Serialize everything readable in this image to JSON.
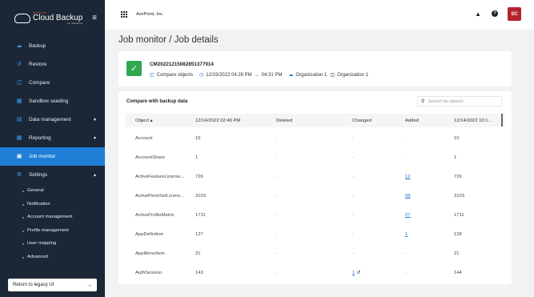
{
  "sidebar": {
    "logo": {
      "brand": "AvePoint",
      "title": "Cloud Backup",
      "subtitle": "For Salesforce"
    },
    "items": [
      {
        "label": "Backup",
        "icon": "cloud-upload-icon"
      },
      {
        "label": "Restore",
        "icon": "restore-icon"
      },
      {
        "label": "Compare",
        "icon": "compare-icon"
      },
      {
        "label": "Sandbox seeding",
        "icon": "database-icon"
      },
      {
        "label": "Data management",
        "icon": "clipboard-icon"
      },
      {
        "label": "Reporting",
        "icon": "chart-icon"
      },
      {
        "label": "Job monitor",
        "icon": "monitor-icon"
      },
      {
        "label": "Settings",
        "icon": "gear-icon"
      }
    ],
    "settings_items": [
      "General",
      "Notification",
      "Account management",
      "Profile management",
      "User mapping",
      "Advanced"
    ],
    "legacy_button": "Return to legacy UI",
    "accent_color": "#1f7fd6"
  },
  "topbar": {
    "tenant": "AvePoint, Inc.",
    "avatar_initials": "SC"
  },
  "page_title": "Job monitor  /  Job details",
  "job": {
    "id": "CM20221215082851377914",
    "type": "Compare objects",
    "time_start": "12/15/2022 04:28 PM",
    "time_end": "04:31 PM",
    "source_org": "Organization 1",
    "target_org": "Organization 1",
    "status_color": "#2fa84f"
  },
  "table": {
    "title": "Compare with backup data",
    "search_placeholder": "Search by objects",
    "columns": [
      "Object ▴",
      "12/14/2022 02:46 PM",
      "Deleted",
      "Changed",
      "Added",
      "12/14/2022 10:1..."
    ],
    "rows": [
      [
        "Account",
        "15",
        "-",
        "-",
        "-",
        "15"
      ],
      [
        "AccountShare",
        "1",
        "-",
        "-",
        "-",
        "1"
      ],
      [
        "ActiveFeatureLicense...",
        "726",
        "-",
        "-",
        "12",
        "726"
      ],
      [
        "ActivePermSetLicens...",
        "3103",
        "-",
        "-",
        "58",
        "3103"
      ],
      [
        "ActiveProfileMetric",
        "1711",
        "-",
        "-",
        "27",
        "1711"
      ],
      [
        "AppDefinition",
        "127",
        "-",
        "-",
        "1",
        "128"
      ],
      [
        "AppMenuItem",
        "21",
        "-",
        "-",
        "-",
        "21"
      ],
      [
        "AuthSession",
        "143",
        "-",
        "1",
        "-",
        "144"
      ]
    ]
  }
}
